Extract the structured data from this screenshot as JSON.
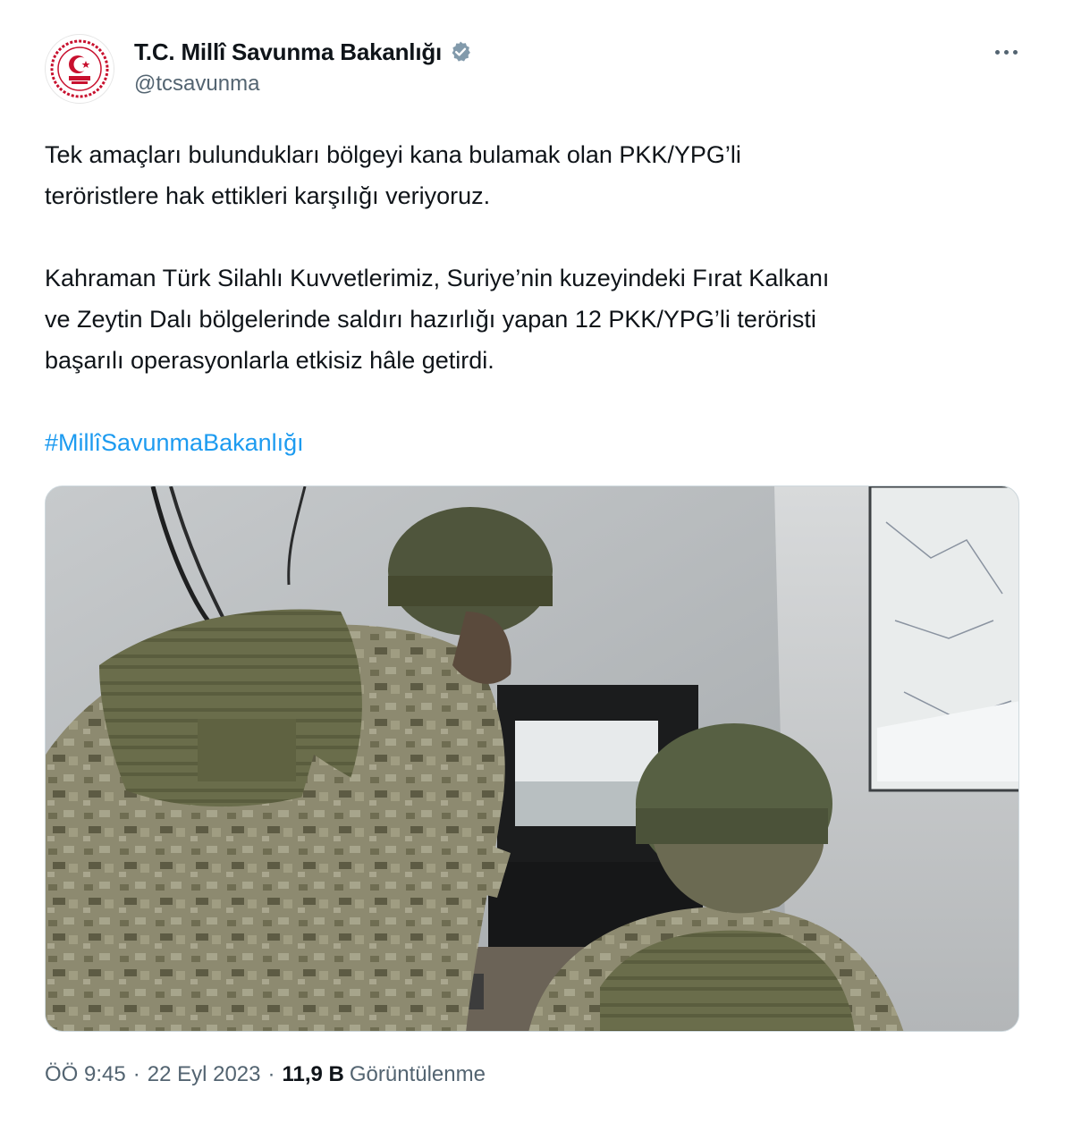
{
  "author": {
    "display_name": "T.C. Millî Savunma Bakanlığı",
    "handle": "@tcsavunma",
    "verified_badge_icon": "verified-badge-icon",
    "avatar_icon": "ministry-emblem-icon",
    "badge_color": "#829aab"
  },
  "tweet": {
    "paragraph_1": "Tek amaçları bulundukları bölgeyi kana bulamak olan PKK/YPG’li\nteröristlere hak ettikleri karşılığı veriyoruz.",
    "paragraph_2": "Kahraman Türk Silahlı Kuvvetlerimiz, Suriye’nin kuzeyindeki Fırat Kalkanı\nve Zeytin Dalı bölgelerinde saldırı hazırlığı yapan 12 PKK/YPG’li teröristi\nbaşarılı operasyonlarla etkisiz hâle getirdi.",
    "hashtag": "#MillîSavunmaBakanlığı",
    "hashtag_color": "#1d9bf0"
  },
  "media": {
    "kind": "photo"
  },
  "footer": {
    "time": "ÖÖ 9:45",
    "separator": "·",
    "date": "22 Eyl 2023",
    "views_count": "11,9 B",
    "views_label": "Görüntülenme"
  },
  "menu": {
    "more_icon": "more-horizontal-icon"
  },
  "colors": {
    "text": "#0f1419",
    "secondary": "#536471",
    "accent": "#1d9bf0",
    "emblem_red": "#c8102e"
  }
}
